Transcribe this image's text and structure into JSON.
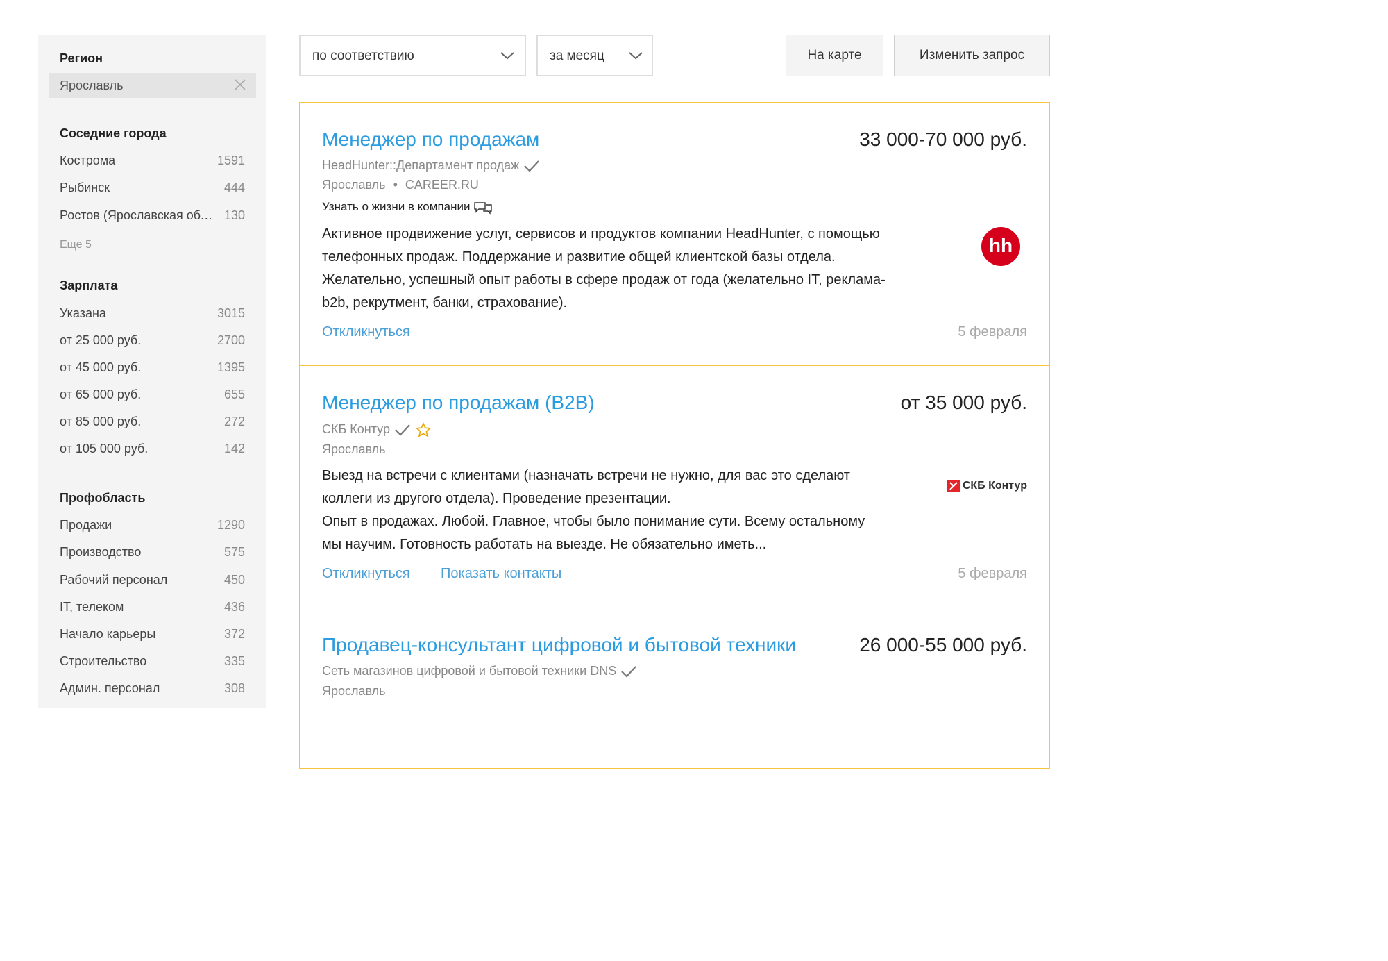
{
  "sidebar": {
    "region": {
      "title": "Регион",
      "value": "Ярославль"
    },
    "nearby": {
      "title": "Соседние города",
      "items": [
        {
          "name": "Кострома",
          "count": "1591"
        },
        {
          "name": "Рыбинск",
          "count": "444"
        },
        {
          "name": "Ростов (Ярославская область)",
          "count": "130"
        }
      ],
      "more": "Еще 5"
    },
    "salary": {
      "title": "Зарплата",
      "items": [
        {
          "name": "Указана",
          "count": "3015"
        },
        {
          "name": "от 25 000 руб.",
          "count": "2700"
        },
        {
          "name": "от 45 000 руб.",
          "count": "1395"
        },
        {
          "name": "от 65 000 руб.",
          "count": "655"
        },
        {
          "name": "от 85 000 руб.",
          "count": "272"
        },
        {
          "name": "от 105 000 руб.",
          "count": "142"
        }
      ]
    },
    "prof": {
      "title": "Профобласть",
      "items": [
        {
          "name": "Продажи",
          "count": "1290"
        },
        {
          "name": "Производство",
          "count": "575"
        },
        {
          "name": "Рабочий персонал",
          "count": "450"
        },
        {
          "name": "IT, телеком",
          "count": "436"
        },
        {
          "name": "Начало карьеры",
          "count": "372"
        },
        {
          "name": "Строительство",
          "count": "335"
        },
        {
          "name": "Админ. персонал",
          "count": "308"
        }
      ]
    }
  },
  "toolbar": {
    "sort_value": "по соответствию",
    "period_value": "за месяц",
    "map_label": "На карте",
    "change_label": "Изменить запрос"
  },
  "vacancies": [
    {
      "title": "Менеджер по продажам",
      "salary": "33 000-70 000 руб.",
      "company": "HeadHunter::Департамент продаж",
      "city": "Ярославль",
      "source": "CAREER.RU",
      "life": "Узнать о жизни в компании",
      "desc": [
        "Активное продвижение услуг, сервисов и продуктов компании HeadHunter, с помощью",
        "телефонных продаж. Поддержание и развитие общей клиентской базы отдела.",
        "Желательно, успешный опыт работы в сфере продаж от года (желательно IT, реклама-",
        "b2b, рекрутмент, банки, страхование)."
      ],
      "respond": "Откликнуться",
      "date": "5 февраля",
      "logo_text": "hh"
    },
    {
      "title": "Менеджер по продажам (B2B)",
      "salary": "от 35 000 руб.",
      "company": "СКБ Контур",
      "city": "Ярославль",
      "desc": [
        "Выезд на встречи с клиентами (назначать встречи не нужно, для вас это сделают",
        "коллеги из другого отдела). Проведение презентации.",
        "Опыт в продажах. Любой. Главное, чтобы было понимание сути. Всему остальному",
        "мы научим. Готовность работать на выезде. Не обязательно иметь..."
      ],
      "respond": "Откликнуться",
      "contacts": "Показать контакты",
      "date": "5 февраля",
      "logo_text": "СКБ Контур"
    },
    {
      "title": "Продавец-консультант цифровой и бытовой техники",
      "salary": "26 000-55 000 руб.",
      "company": "Сеть магазинов цифровой и бытовой техники DNS",
      "city": "Ярославль"
    }
  ],
  "colors": {
    "link": "#2b9ce0",
    "accent_border": "#f5c542",
    "hh_red": "#d6001c"
  }
}
